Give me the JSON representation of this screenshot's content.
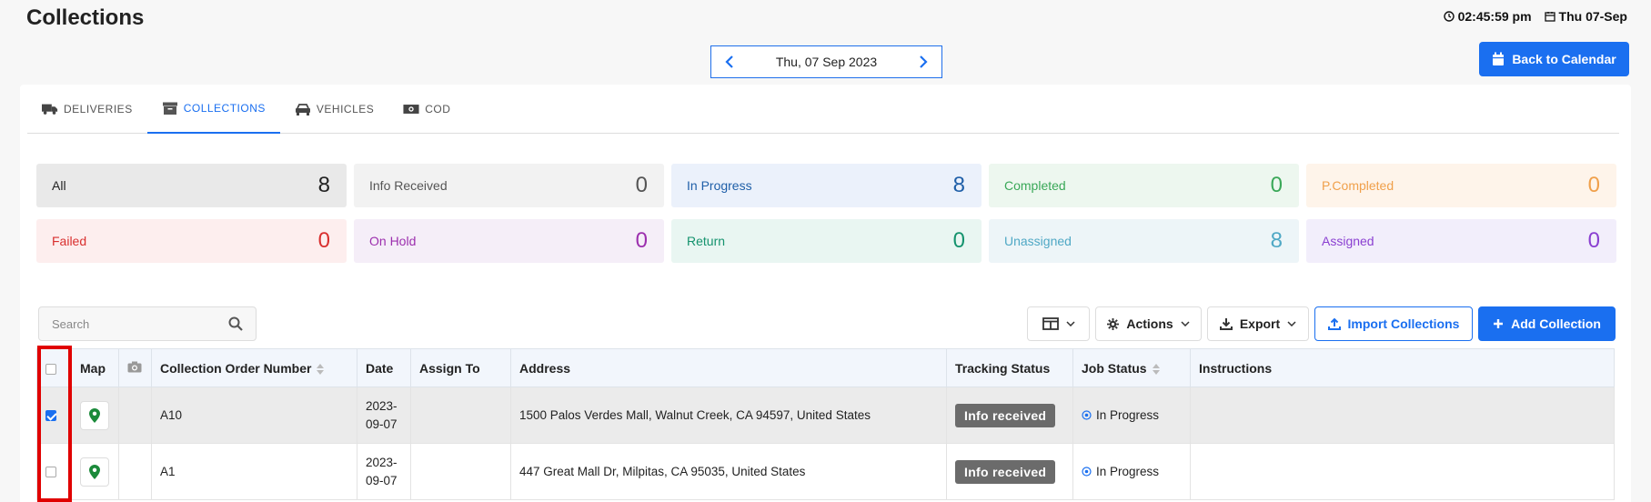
{
  "page": {
    "title": "Collections",
    "time": "02:45:59 pm",
    "date": "Thu 07-Sep",
    "nav_date": "Thu, 07 Sep 2023",
    "back_label": "Back to Calendar"
  },
  "tabs": [
    {
      "label": "DELIVERIES",
      "icon": "truck-icon"
    },
    {
      "label": "COLLECTIONS",
      "icon": "archive-icon"
    },
    {
      "label": "VEHICLES",
      "icon": "car-icon"
    },
    {
      "label": "COD",
      "icon": "money-icon"
    }
  ],
  "stats": [
    {
      "label": "All",
      "count": "8",
      "bg": "#e9e9e9",
      "color": "#222222"
    },
    {
      "label": "Info Received",
      "count": "0",
      "bg": "#f2f2f2",
      "color": "#555555"
    },
    {
      "label": "In Progress",
      "count": "8",
      "bg": "#ebf1fb",
      "color": "#1f5fa8"
    },
    {
      "label": "Completed",
      "count": "0",
      "bg": "#edf7ef",
      "color": "#3aa858"
    },
    {
      "label": "P.Completed",
      "count": "0",
      "bg": "#fef4ea",
      "color": "#f0a04b"
    },
    {
      "label": "Failed",
      "count": "0",
      "bg": "#fdeeee",
      "color": "#d9302f"
    },
    {
      "label": "On Hold",
      "count": "0",
      "bg": "#f5eef8",
      "color": "#9c2fae"
    },
    {
      "label": "Return",
      "count": "0",
      "bg": "#e9f6f2",
      "color": "#15936e"
    },
    {
      "label": "Unassigned",
      "count": "8",
      "bg": "#edf5f8",
      "color": "#4fa8c5"
    },
    {
      "label": "Assigned",
      "count": "0",
      "bg": "#f2eefb",
      "color": "#8a3fd1"
    }
  ],
  "search": {
    "placeholder": "Search"
  },
  "toolbar": {
    "actions_label": "Actions",
    "export_label": "Export",
    "import_label": "Import Collections",
    "add_label": "Add Collection"
  },
  "table": {
    "headers": {
      "map": "Map",
      "order_number": "Collection Order Number",
      "date": "Date",
      "assign_to": "Assign To",
      "address": "Address",
      "tracking_status": "Tracking Status",
      "job_status": "Job Status",
      "instructions": "Instructions"
    },
    "rows": [
      {
        "checked": true,
        "order": "A10",
        "date_line1": "2023-",
        "date_line2": "09-07",
        "assign": "",
        "address": "1500 Palos Verdes Mall, Walnut Creek, CA 94597, United States",
        "tracking": "Info received",
        "job": "In Progress",
        "instructions": ""
      },
      {
        "checked": false,
        "order": "A1",
        "date_line1": "2023-",
        "date_line2": "09-07",
        "assign": "",
        "address": "447 Great Mall Dr, Milpitas, CA 95035, United States",
        "tracking": "Info received",
        "job": "In Progress",
        "instructions": ""
      }
    ]
  }
}
